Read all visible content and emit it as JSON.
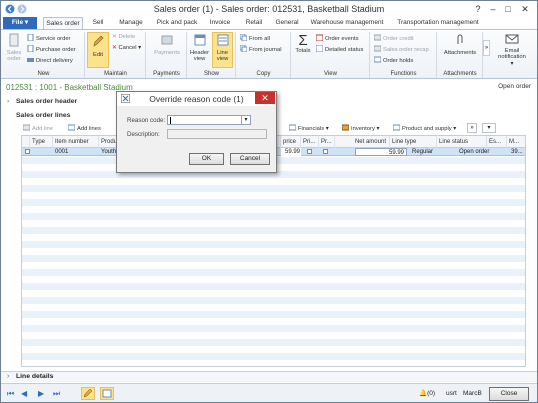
{
  "window": {
    "title": "Sales order (1) - Sales order: 012531, Basketball Stadium",
    "controls": [
      "?",
      "–",
      "□",
      "✕"
    ]
  },
  "tabs": [
    "File",
    "Sales order",
    "Sell",
    "Manage",
    "Pick and pack",
    "Invoice",
    "Retail",
    "General",
    "Warehouse management",
    "Transportation management"
  ],
  "ribbon": {
    "new": {
      "label": "New",
      "sales_order": "Sales order",
      "service_order": "Service order",
      "purchase_order": "Purchase order",
      "direct_delivery": "Direct delivery"
    },
    "maintain": {
      "label": "Maintain",
      "edit": "Edit",
      "delete": "Delete",
      "cancel": "Cancel"
    },
    "payments": {
      "label": "Payments",
      "payments": "Payments"
    },
    "show": {
      "label": "Show",
      "header_view": "Header view",
      "line_view": "Line view"
    },
    "copy": {
      "label": "Copy",
      "from_all": "From all",
      "from_journal": "From journal"
    },
    "view": {
      "label": "View",
      "totals": "Totals",
      "order_events": "Order events",
      "detailed_status": "Detailed status"
    },
    "functions": {
      "label": "Functions",
      "order_credit": "Order credit",
      "sales_order_recap": "Sales order recap",
      "order_holds": "Order holds"
    },
    "attachments": {
      "label": "Attachments",
      "attachments": "Attachments"
    },
    "email": {
      "label": "Email notification"
    }
  },
  "heading": {
    "title": "012531 : 1001 - Basketball Stadium",
    "right": "Open order"
  },
  "sections": {
    "header": "Sales order header",
    "lines": "Sales order lines",
    "line_details": "Line details"
  },
  "lines_toolbar": {
    "add_line": "Add line",
    "add_lines": "Add lines",
    "financials": "Financials",
    "inventory": "Inventory",
    "product_supply": "Product and supply"
  },
  "grid": {
    "columns": [
      "Type",
      "Item number",
      "Produ",
      "price",
      "Pri...",
      "Pr...",
      "Net amount",
      "Line type",
      "Line status",
      "Es...",
      "M..."
    ],
    "row": {
      "item": "0001",
      "product": "Youth",
      "price": "59.99",
      "net_amount": "59.99",
      "line_type": "Regular",
      "line_status": "Open order",
      "es": "39..."
    }
  },
  "dialog": {
    "title": "Override reason code (1)",
    "reason_label": "Reason code:",
    "description_label": "Description:",
    "reason_value": "",
    "description_value": "",
    "ok": "OK",
    "cancel": "Cancel"
  },
  "status": {
    "count": "(0)",
    "user": "usrt",
    "company": "MarcB",
    "close": "Close"
  }
}
